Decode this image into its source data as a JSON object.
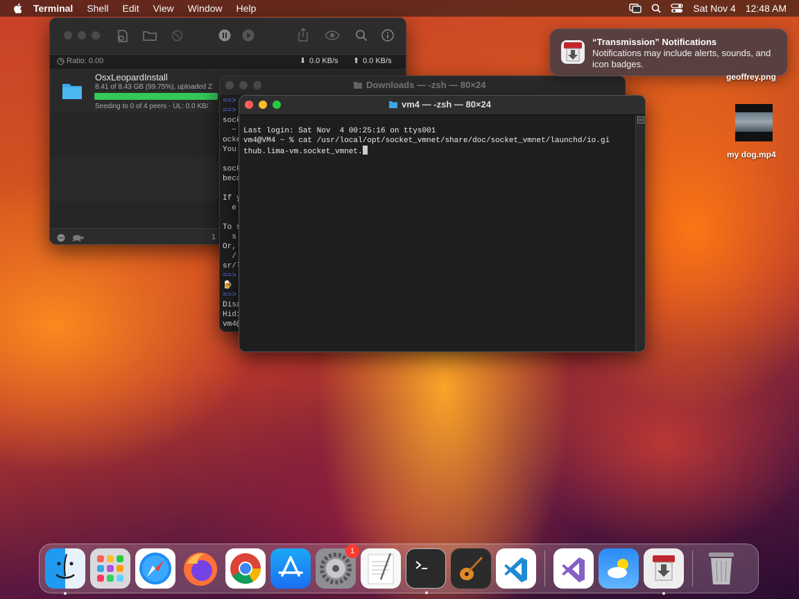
{
  "menubar": {
    "app": "Terminal",
    "menus": [
      "Shell",
      "Edit",
      "View",
      "Window",
      "Help"
    ],
    "date": "Sat Nov 4",
    "time": "12:48 AM"
  },
  "transmission": {
    "ratio": "Ratio: 0.00",
    "down_rate": "0.0 KB/s",
    "up_rate": "0.0 KB/s",
    "torrent_name": "OsxLeopardInstall",
    "progress_text": "8.41 of 8.43 GB (99.75%), uploaded Z",
    "progress_fraction": 0.9975,
    "status_text": "Seeding to 0 of 4 peers - UL: 0.0 KB/",
    "footer_count": "1"
  },
  "terminal_back": {
    "title": "Downloads — -zsh — 80×24",
    "lines": [
      "==>",
      "==>",
      "sock",
      "  ~",
      "ocke",
      "You",
      "",
      "sock",
      "beca",
      "",
      "If y",
      "  e",
      "",
      "To s",
      "  s",
      "Or,",
      "  /",
      "sr/l",
      "==>",
      "🍺",
      "==>",
      "Disa",
      "Hidi",
      "vm4@"
    ]
  },
  "terminal_front": {
    "title": "vm4 — -zsh — 80×24",
    "lines": [
      "Last login: Sat Nov  4 00:25:16 on ttys001",
      "vm4@VM4 ~ % cat /usr/local/opt/socket_vmnet/share/doc/socket_vmnet/launchd/io.gi",
      "thub.lima-vm.socket_vmnet."
    ]
  },
  "notification": {
    "title": "“Transmission” Notifications",
    "body": "Notifications may include alerts, sounds, and icon badges."
  },
  "desktop": {
    "file1": "geoffrey.png",
    "file2": "my dog.mp4"
  },
  "dock": {
    "badge_count": "1"
  },
  "colors": {
    "terminal_bg": "#1e1e1e",
    "progress_green": "#34c759",
    "close": "#ff5f57",
    "minimize": "#febc2e",
    "zoom": "#28c840"
  }
}
